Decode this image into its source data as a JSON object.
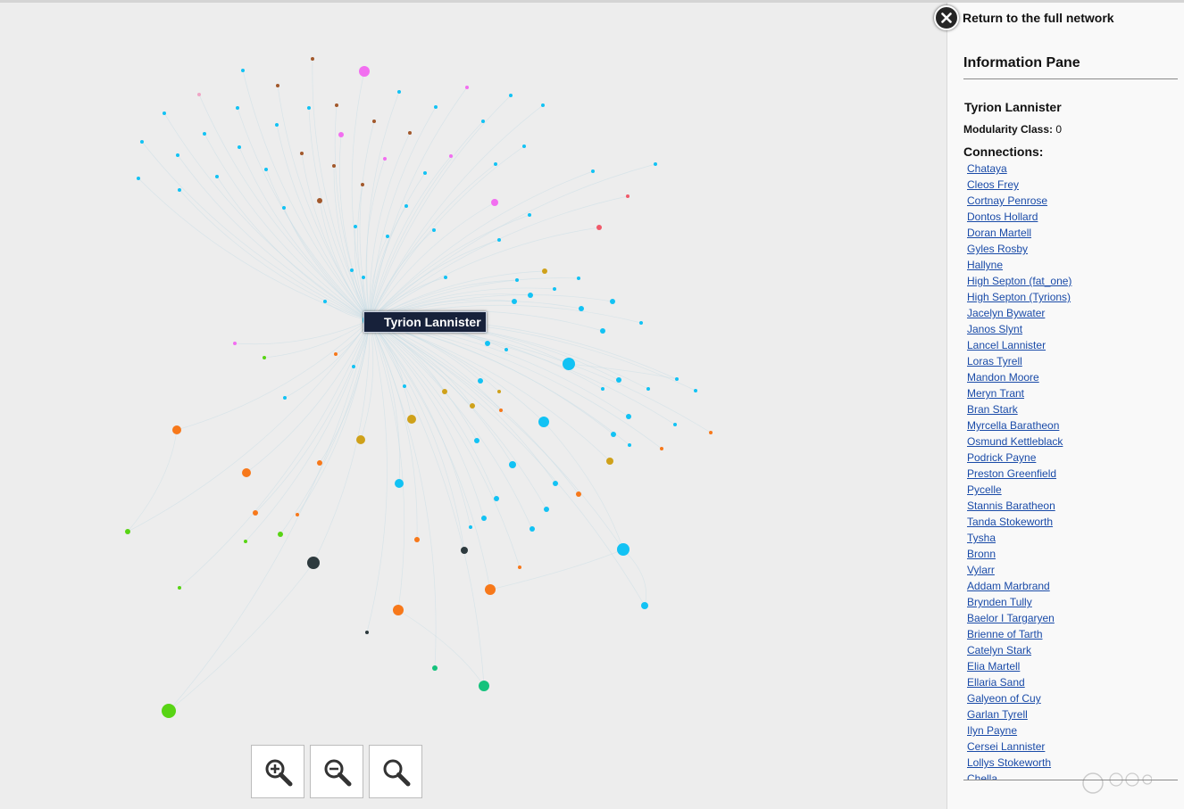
{
  "panel": {
    "return_label": "Return to the full network",
    "title": "Information Pane",
    "selected_name": "Tyrion Lannister",
    "modularity_label": "Modularity Class:",
    "modularity_value": "0",
    "connections_label": "Connections:",
    "connections": [
      "Chataya",
      "Cleos Frey",
      "Cortnay Penrose",
      "Dontos Hollard",
      "Doran Martell",
      "Gyles Rosby",
      "Hallyne",
      "High Septon (fat_one)",
      "High Septon (Tyrions)",
      "Jacelyn Bywater",
      "Janos Slynt",
      "Lancel Lannister",
      "Loras Tyrell",
      "Mandon Moore",
      "Meryn Trant",
      "Bran Stark",
      "Myrcella Baratheon",
      "Osmund Kettleblack",
      "Podrick Payne",
      "Preston Greenfield",
      "Pycelle",
      "Stannis Baratheon",
      "Tanda Stokeworth",
      "Tysha",
      "Bronn",
      "Vylarr",
      "Addam Marbrand",
      "Brynden Tully",
      "Baelor I Targaryen",
      "Brienne of Tarth",
      "Catelyn Stark",
      "Elia Martell",
      "Ellaria Sand",
      "Galyeon of Cuy",
      "Garlan Tyrell",
      "Ilyn Payne",
      "Cersei Lannister",
      "Lollys Stokeworth",
      "Chella"
    ]
  },
  "graph": {
    "focus_label": "Tyrion Lannister",
    "colors": {
      "cyan": "#12c2f4",
      "orange": "#f7781a",
      "green": "#58d414",
      "magenta": "#f26ef0",
      "brown": "#a2582b",
      "gold": "#cfa11a",
      "dark": "#2d3a3e",
      "teal": "#14c27c",
      "pink": "#f0a6c6",
      "red": "#f05a6a",
      "edge": "#c7dde6"
    }
  },
  "zoom": {
    "in_icon": "zoom-in-icon",
    "out_icon": "zoom-out-icon",
    "reset_icon": "zoom-reset-icon"
  },
  "icons": {
    "close": "close-icon",
    "license": "creative-commons-icon"
  }
}
